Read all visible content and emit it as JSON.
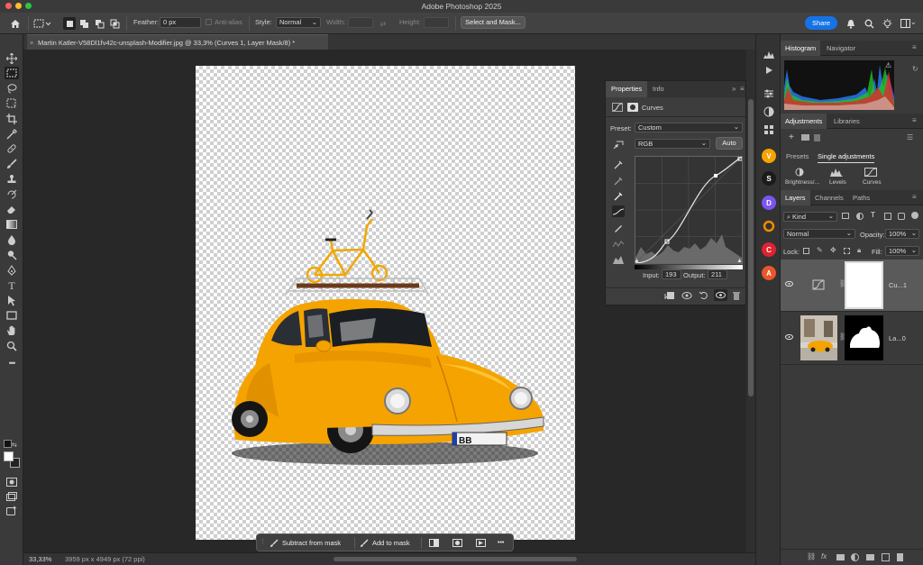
{
  "app_title": "Adobe Photoshop 2025",
  "options_bar": {
    "feather_label": "Feather:",
    "feather_value": "0 px",
    "anti_alias_label": "Anti-alias",
    "style_label": "Style:",
    "style_value": "Normal",
    "width_label": "Width:",
    "height_label": "Height:",
    "select_mask_button": "Select and Mask...",
    "share_button": "Share"
  },
  "document_tab": {
    "title": "Martin Katler-V58Dl1fv42c-unsplash-Modifier.jpg @ 33,3% (Curves 1, Layer Mask/8) *"
  },
  "status_bar": {
    "zoom": "33,33%",
    "doc_info": "3959 px x 4949 px (72 ppi)"
  },
  "context_bar": {
    "subtract_label": "Subtract from mask",
    "add_label": "Add to mask",
    "more_label": "•••"
  },
  "properties": {
    "tabs": [
      "Properties",
      "Info"
    ],
    "adjustment_name": "Curves",
    "preset_label": "Preset:",
    "preset_value": "Custom",
    "channel_value": "RGB",
    "auto_button": "Auto",
    "input_label": "Input:",
    "input_value": "193",
    "output_label": "Output:",
    "output_value": "211"
  },
  "histogram_panel": {
    "tabs": [
      "Histogram",
      "Navigator"
    ]
  },
  "adjustments_panel": {
    "tabs": [
      "Adjustments",
      "Libraries"
    ],
    "subtabs": [
      "Presets",
      "Single adjustments"
    ],
    "items": [
      "Brightness/...",
      "Levels",
      "Curves"
    ]
  },
  "layers_panel": {
    "tabs": [
      "Layers",
      "Channels",
      "Paths"
    ],
    "filter_value": "Kind",
    "blend_mode": "Normal",
    "opacity_label": "Opacity:",
    "opacity_value": "100%",
    "lock_label": "Lock:",
    "fill_label": "Fill:",
    "fill_value": "100%",
    "layers": [
      {
        "name": "Cu...1"
      },
      {
        "name": "La...0"
      }
    ]
  },
  "right_strip_badges": [
    "V",
    "S",
    "D",
    "C",
    "A"
  ],
  "colors": {
    "accent": "#1473e6",
    "car_yellow": "#f5a300",
    "panel_bg": "#3a3a3a"
  }
}
